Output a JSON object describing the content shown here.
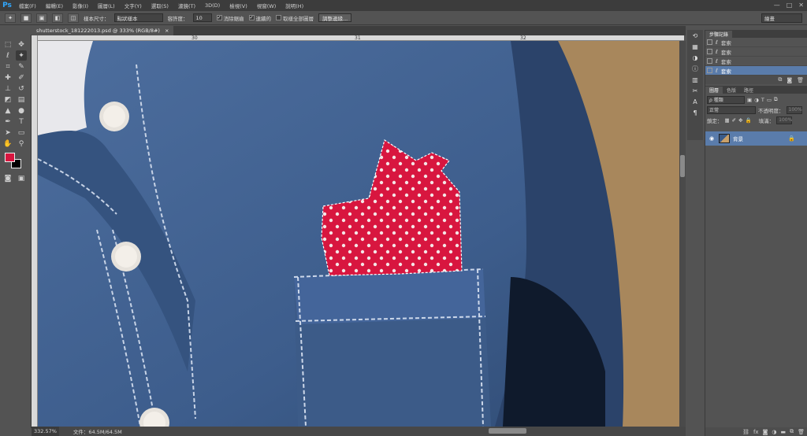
{
  "app": {
    "logo": "Ps"
  },
  "menu": [
    "檔案(F)",
    "編輯(E)",
    "影像(I)",
    "圖層(L)",
    "文字(Y)",
    "選取(S)",
    "濾鏡(T)",
    "3D(D)",
    "檢視(V)",
    "視窗(W)",
    "說明(H)"
  ],
  "window_controls": [
    "—",
    "□",
    "✕"
  ],
  "options": {
    "sample_size_label": "樣本尺寸：",
    "sample_size_value": "點狀樣本",
    "tolerance_label": "容許度：",
    "tolerance_value": "10",
    "antialias_label": "消除鋸齒",
    "contiguous_label": "連續的",
    "sample_all_label": "取樣全部圖層",
    "refine_edge_label": "調整邊緣...",
    "workspace_value": "繪畫"
  },
  "document": {
    "tab_title": "shutterstock_181222013.psd @ 333% (RGB/8#)",
    "ruler_labels": [
      "30",
      "31",
      "32"
    ]
  },
  "status": {
    "zoom": "332.57%",
    "doc_size": "文件：64.5M/64.5M"
  },
  "history": {
    "tabs": [
      "步驟記錄"
    ],
    "rows": [
      "套索",
      "套索",
      "套索",
      "套索"
    ]
  },
  "layers": {
    "tabs": [
      "圖層",
      "色版",
      "路徑"
    ],
    "filter_label": "ρ 種類",
    "blend_mode": "正常",
    "opacity_label": "不透明度：",
    "opacity_value": "100%",
    "lock_label": "鎖定：",
    "fill_label": "填滿：",
    "fill_value": "100%",
    "layer_name": "背景"
  },
  "colors": {
    "foreground": "#d8163f",
    "background": "#000000",
    "accent": "#5a7cab"
  }
}
